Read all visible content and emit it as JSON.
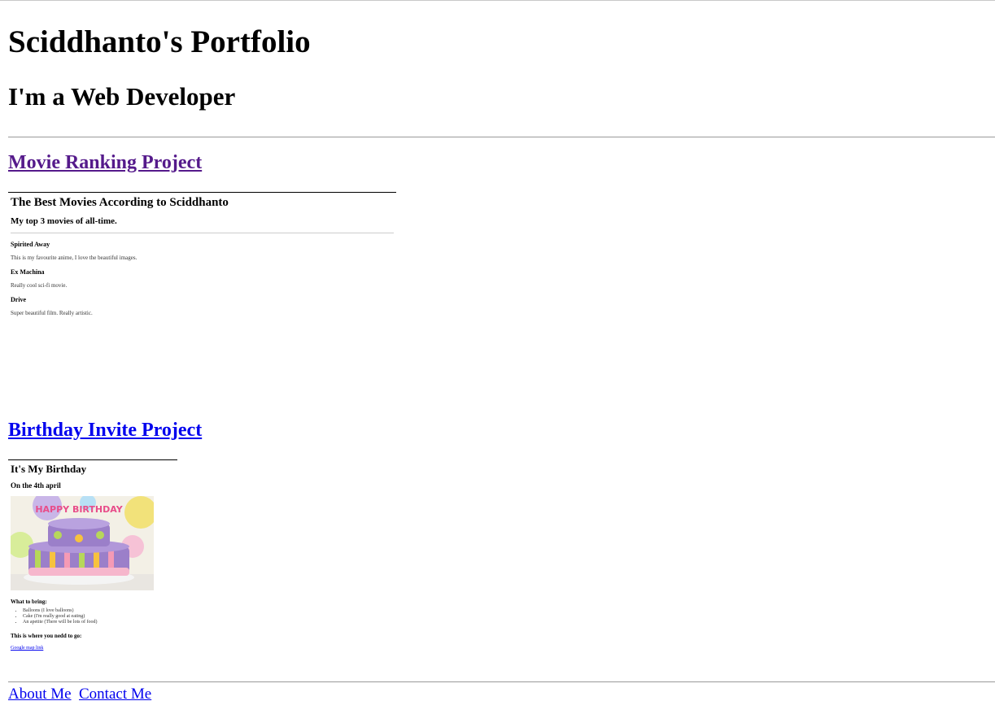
{
  "header": {
    "title": "Sciddhanto's Portfolio",
    "subtitle": "I'm a Web Developer"
  },
  "projects": [
    {
      "link_text": "Movie Ranking Project",
      "visited": true,
      "content": {
        "heading": "The Best Movies According to Sciddhanto",
        "subheading": "My top 3 movies of all-time.",
        "movies": [
          {
            "name": "Spirited Away",
            "description": "This is my favourite anime, I love the beautiful images."
          },
          {
            "name": "Ex Machina",
            "description": "Really cool sci-fi movie."
          },
          {
            "name": "Drive",
            "description": "Super beautiful film. Really artistic."
          }
        ]
      }
    },
    {
      "link_text": "Birthday Invite Project",
      "visited": false,
      "content": {
        "heading": "It's My Birthday",
        "subheading": "On the 4th april",
        "image_label": "HAPPY BIRTHDAY",
        "bring_heading": "What to bring:",
        "bring_items": [
          "Balloons (I love balloons)",
          "Cake (I'm really good at eating)",
          "An apetite (There will be lots of food)"
        ],
        "where_heading": "This is where you nedd to go:",
        "map_link": "Google map link"
      }
    }
  ],
  "footer": {
    "links": [
      "About Me",
      "Contact Me"
    ]
  },
  "colors": {
    "link": "#0000ee",
    "visited_link": "#551a8b",
    "rule": "#999999"
  }
}
